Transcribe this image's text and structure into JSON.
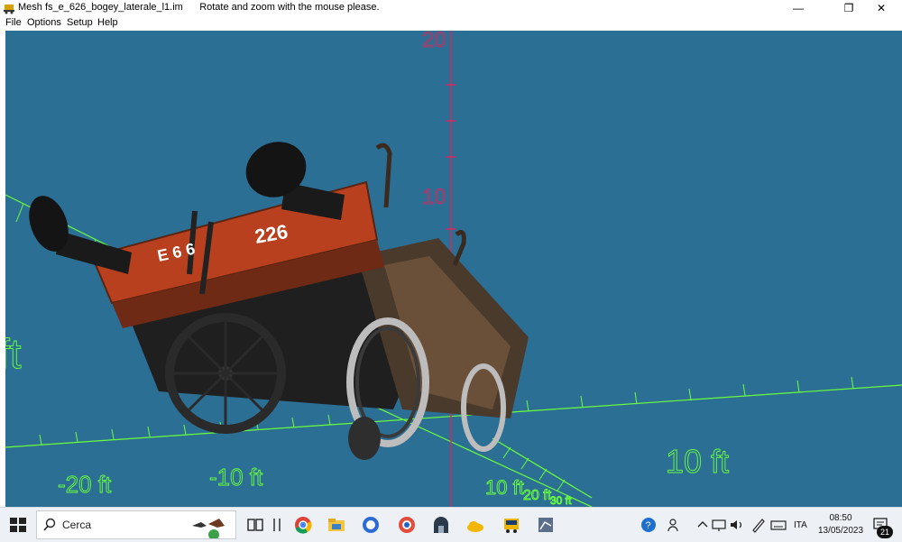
{
  "window": {
    "title": "Mesh fs_e_626_bogey_laterale_l1.im",
    "hint": "Rotate and zoom with the mouse please.",
    "controls": {
      "minimize": "—",
      "restore": "❐",
      "close": "✕"
    }
  },
  "menu": [
    {
      "label": "File"
    },
    {
      "label": "Options"
    },
    {
      "label": "Setup"
    },
    {
      "label": "Help"
    }
  ],
  "viewport": {
    "background": "#2c6f95",
    "grid_color": "#6bff3a",
    "axis_color": "#e0245a",
    "vertical_labels": [
      "20",
      "10"
    ],
    "axis_labels": [
      "-20 ft",
      "-10 ft",
      "10 ft",
      "10 ft",
      "20 ft",
      "30 ft",
      "ft"
    ],
    "model": {
      "number": "226",
      "class_label": "E 6 6"
    }
  },
  "taskbar": {
    "search_placeholder": "Cerca",
    "time": "08:50",
    "date": "13/05/2023",
    "language": "ITA",
    "notification_count": "21"
  }
}
